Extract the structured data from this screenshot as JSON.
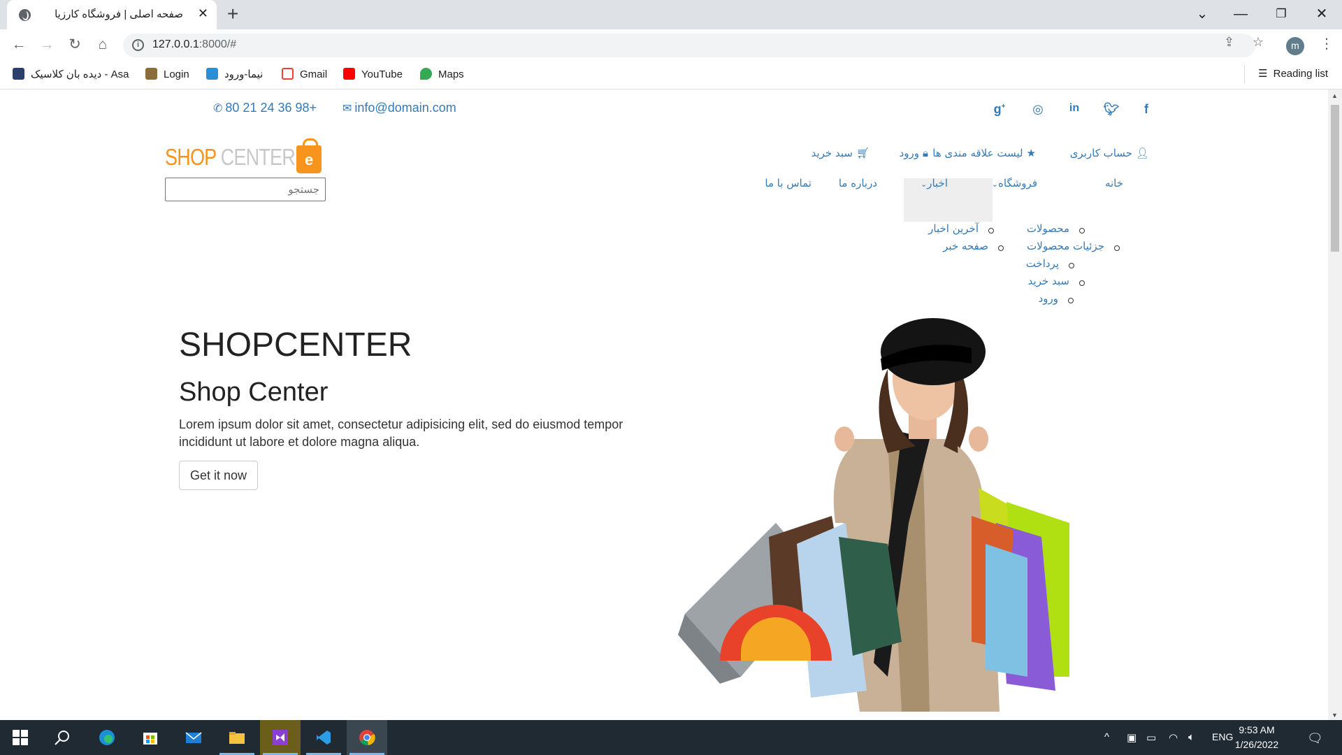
{
  "browser": {
    "tab_title": "صفحه اصلی | فروشگاه کارزیا",
    "tab_close": "✕",
    "new_tab": "+",
    "url_host": "127.0.0.1",
    "url_rest": ":8000/#",
    "avatar_letter": "m",
    "bookmarks": [
      {
        "label": "دیده بان کلاسیک - Asa",
        "icon": "asa-icon"
      },
      {
        "label": "Login",
        "icon": "login-icon"
      },
      {
        "label": "نیما-ورود",
        "icon": "nima-icon"
      },
      {
        "label": "Gmail",
        "icon": "gmail-icon"
      },
      {
        "label": "YouTube",
        "icon": "youtube-icon"
      },
      {
        "label": "Maps",
        "icon": "maps-icon"
      }
    ],
    "reading_list": "Reading list"
  },
  "topbar": {
    "phone": "80 21 24 36 98+",
    "email": "info@domain.com",
    "social": [
      "g+",
      "dribbble",
      "in",
      "twitter",
      "f"
    ]
  },
  "logo": {
    "shop": "SHOP",
    "center": " CENTER",
    "e": "e"
  },
  "search": {
    "placeholder": "جستجو"
  },
  "account_menu": {
    "account": "حساب کاربری",
    "wishlist": "لیست علاقه مندی ها",
    "login": "ورود",
    "cart": "سبد خرید"
  },
  "nav": {
    "home": "خانه",
    "shop": "فروشگاه",
    "news": "اخبار",
    "about": "درباره ما",
    "contact": "تماس با ما",
    "shop_submenu": [
      "محصولات",
      "جزئیات محصولات",
      "پرداخت",
      "سبد خرید",
      "ورود"
    ],
    "news_submenu": [
      "آخرین اخبار",
      "صفحه خبر"
    ]
  },
  "hero": {
    "title": "SHOPCENTER",
    "subtitle": "Shop Center",
    "text": "Lorem ipsum dolor sit amet, consectetur adipisicing elit, sed do eiusmod tempor incididunt ut labore et dolore magna aliqua.",
    "button": "Get it now"
  },
  "taskbar": {
    "lang": "ENG",
    "time": "9:53 AM",
    "date": "1/26/2022"
  },
  "colors": {
    "link": "#337ab7",
    "logo_orange": "#f7941d",
    "taskbar": "#1f2a33"
  }
}
